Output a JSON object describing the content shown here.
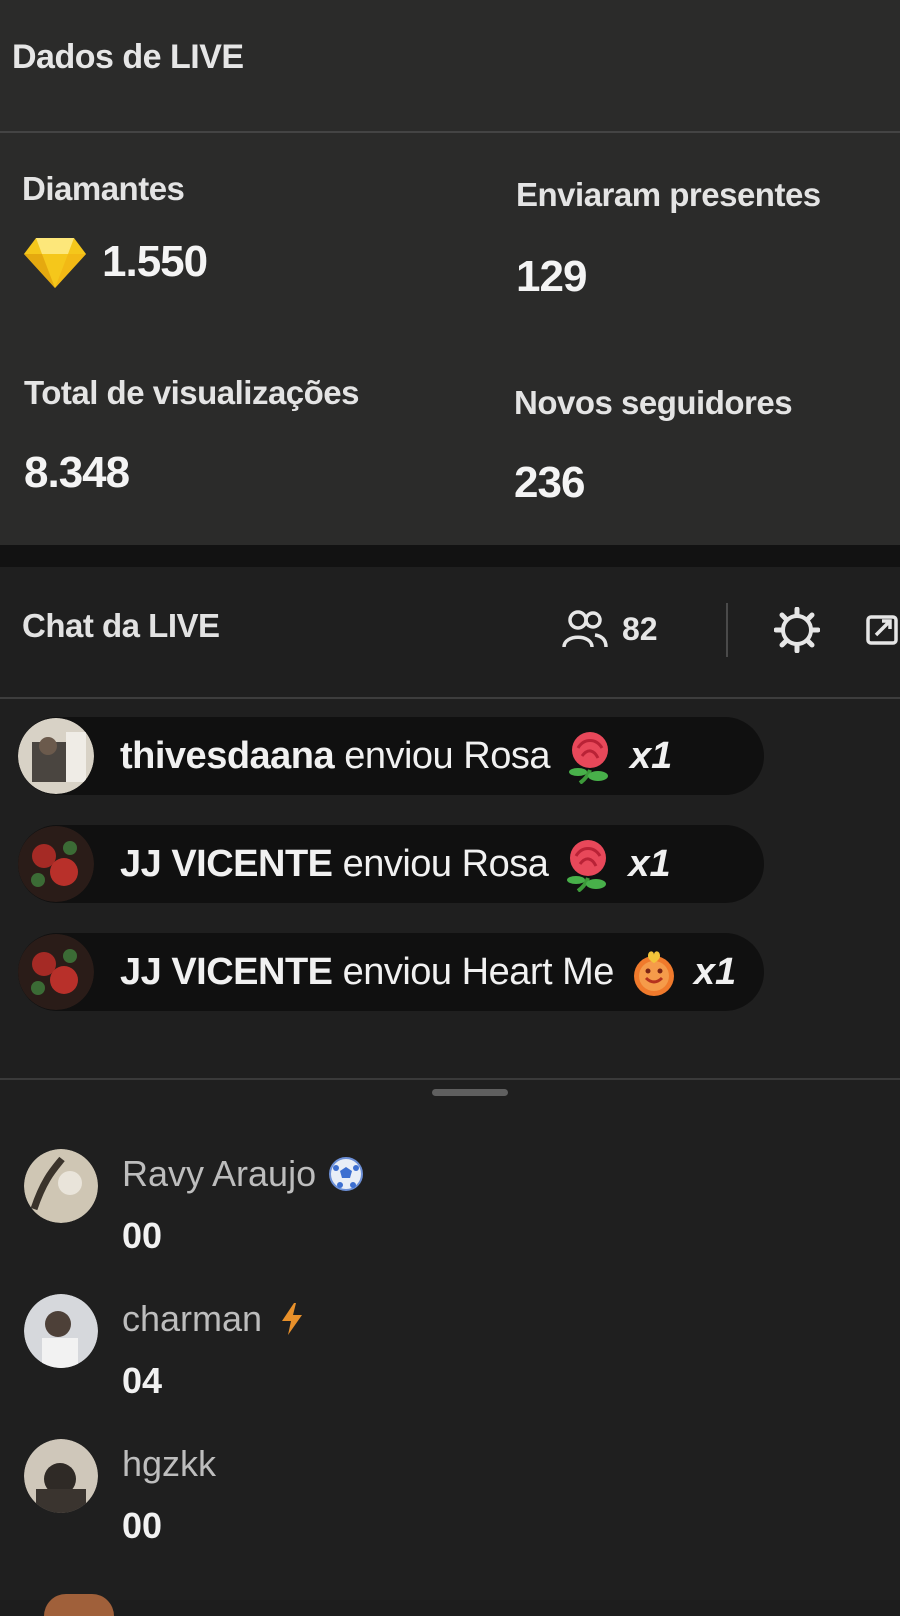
{
  "stats": {
    "title": "Dados de LIVE",
    "items": [
      {
        "label": "Diamantes",
        "value": "1.550",
        "icon": "diamond-icon"
      },
      {
        "label": "Enviaram presentes",
        "value": "129"
      },
      {
        "label": "Total de visualizações",
        "value": "8.348"
      },
      {
        "label": "Novos seguidores",
        "value": "236"
      }
    ]
  },
  "chat": {
    "title": "Chat da LIVE",
    "viewer_count": "82",
    "icons": [
      "people-icon",
      "gear-icon",
      "share-icon"
    ],
    "gifts": [
      {
        "user": "thivesdaana",
        "verb": " enviou ",
        "gift": "Rosa",
        "count": "x1",
        "gift_icon": "rose-icon"
      },
      {
        "user": "JJ VICENTE",
        "verb": " enviou ",
        "gift": "Rosa",
        "count": "x1",
        "gift_icon": "rose-icon"
      },
      {
        "user": "JJ VICENTE",
        "verb": " enviou ",
        "gift": "Heart Me",
        "count": "x1",
        "gift_icon": "heart-me-icon"
      }
    ],
    "comments": [
      {
        "user": "Ravy Araujo",
        "text": "00",
        "badge": "soccer-ball-icon"
      },
      {
        "user": "charman",
        "text": "04",
        "badge": "lightning-icon"
      },
      {
        "user": "hgzkk",
        "text": "00"
      }
    ]
  },
  "colors": {
    "stats_bg": "#2b2b2a",
    "chat_bg": "#1f1f1f",
    "gift_row_bg": "#101010",
    "diamond": "#f5c71b",
    "lightning": "#e8902a"
  }
}
